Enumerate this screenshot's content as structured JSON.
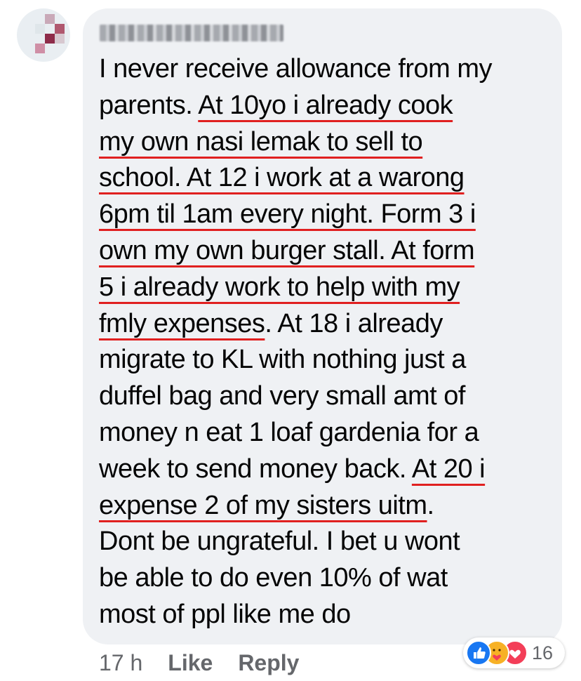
{
  "comment": {
    "lines": [
      [
        {
          "t": "I never receive allowance from my",
          "u": false
        }
      ],
      [
        {
          "t": "parents. ",
          "u": false
        },
        {
          "t": "At 10yo i already cook",
          "u": true
        }
      ],
      [
        {
          "t": "my own nasi lemak to sell to",
          "u": true
        }
      ],
      [
        {
          "t": "school. At 12 i work at a warong",
          "u": true
        }
      ],
      [
        {
          "t": "6pm til 1am every night. Form 3 i",
          "u": true
        }
      ],
      [
        {
          "t": "own my own burger stall. At form",
          "u": true
        }
      ],
      [
        {
          "t": "5 i already work to help with my",
          "u": true
        }
      ],
      [
        {
          "t": "fmly expenses",
          "u": true
        },
        {
          "t": ". At 18 i already",
          "u": false
        }
      ],
      [
        {
          "t": "migrate to KL with nothing just a",
          "u": false
        }
      ],
      [
        {
          "t": "duffel bag and very small amt of",
          "u": false
        }
      ],
      [
        {
          "t": "money n eat 1 loaf gardenia for a",
          "u": false
        }
      ],
      [
        {
          "t": "week to send money back. ",
          "u": false
        },
        {
          "t": "At 20 i",
          "u": true
        }
      ],
      [
        {
          "t": "expense 2 of my sisters uitm",
          "u": true
        },
        {
          "t": ".",
          "u": false
        }
      ],
      [
        {
          "t": "Dont be ungrateful. I bet u wont",
          "u": false
        }
      ],
      [
        {
          "t": "be able to do even 10% of wat",
          "u": false
        }
      ],
      [
        {
          "t": "most of ppl like me do",
          "u": false
        }
      ]
    ]
  },
  "footer": {
    "time": "17 h",
    "like_label": "Like",
    "reply_label": "Reply"
  },
  "reactions": {
    "icons": [
      "like-icon",
      "care-icon",
      "love-icon"
    ],
    "count": "16",
    "colors": {
      "like": "#1877f2",
      "care": "#f7b125",
      "love": "#f33e58",
      "underline": "#e02020"
    }
  }
}
